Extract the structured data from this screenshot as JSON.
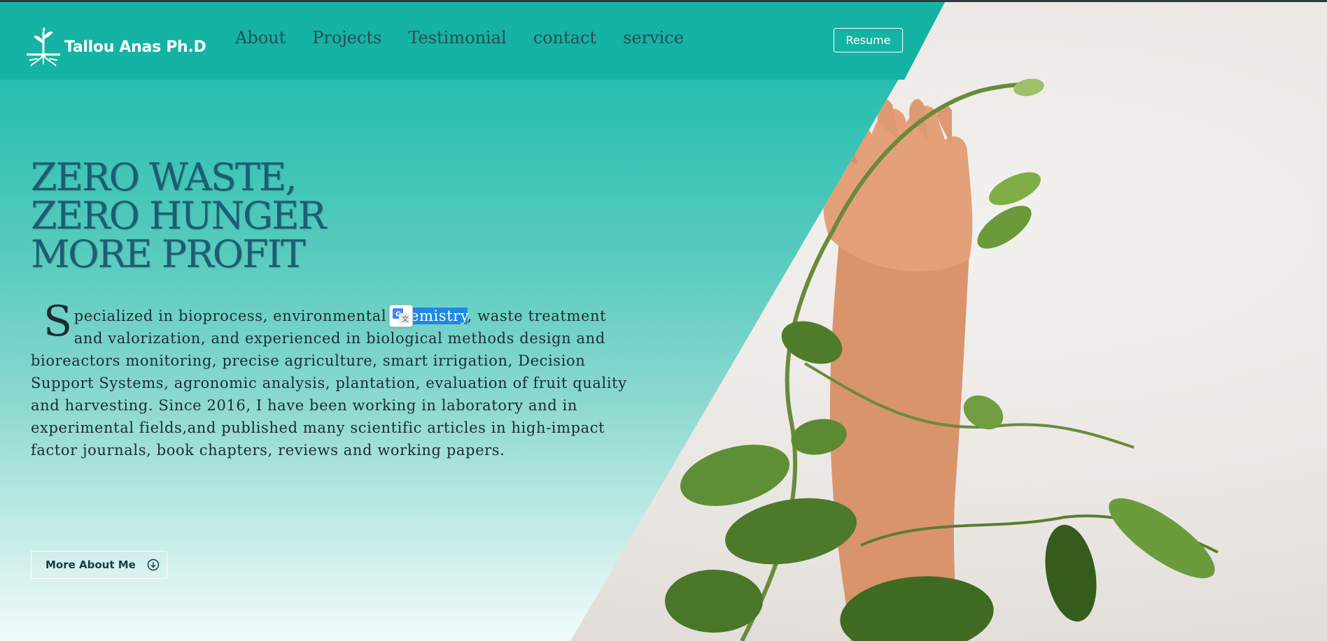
{
  "brand": {
    "name": "Tallou Anas Ph.D",
    "logo_icon": "plant-roots-logo-icon"
  },
  "nav": {
    "items": [
      {
        "label": "About"
      },
      {
        "label": "Projects"
      },
      {
        "label": "Testimonial"
      },
      {
        "label": "contact"
      },
      {
        "label": "service"
      }
    ],
    "resume_label": "Resume"
  },
  "hero": {
    "headline": [
      "ZERO WASTE,",
      "ZERO HUNGER",
      "MORE PROFIT"
    ],
    "intro": {
      "dropcap": "S",
      "before_selection": "pecialized in bioprocess, environmental ",
      "selected": "chemistry",
      "after_selection": ", waste treatment and valorization, and experienced in biological methods design and bioreactors monitoring, precise agriculture, smart irrigation, Decision Support Systems, agronomic analysis, plantation, evaluation of fruit quality and harvesting. Since 2016, I have been working in laboratory and in experimental fields,and published many scientific articles in high-impact factor journals, book chapters, reviews and working papers."
    },
    "translate_icon": "google-translate-icon",
    "more_button_label": "More About Me"
  },
  "colors": {
    "accent": "#14b3a3",
    "headline": "#1d5d73",
    "selection": "#1e88e5"
  }
}
